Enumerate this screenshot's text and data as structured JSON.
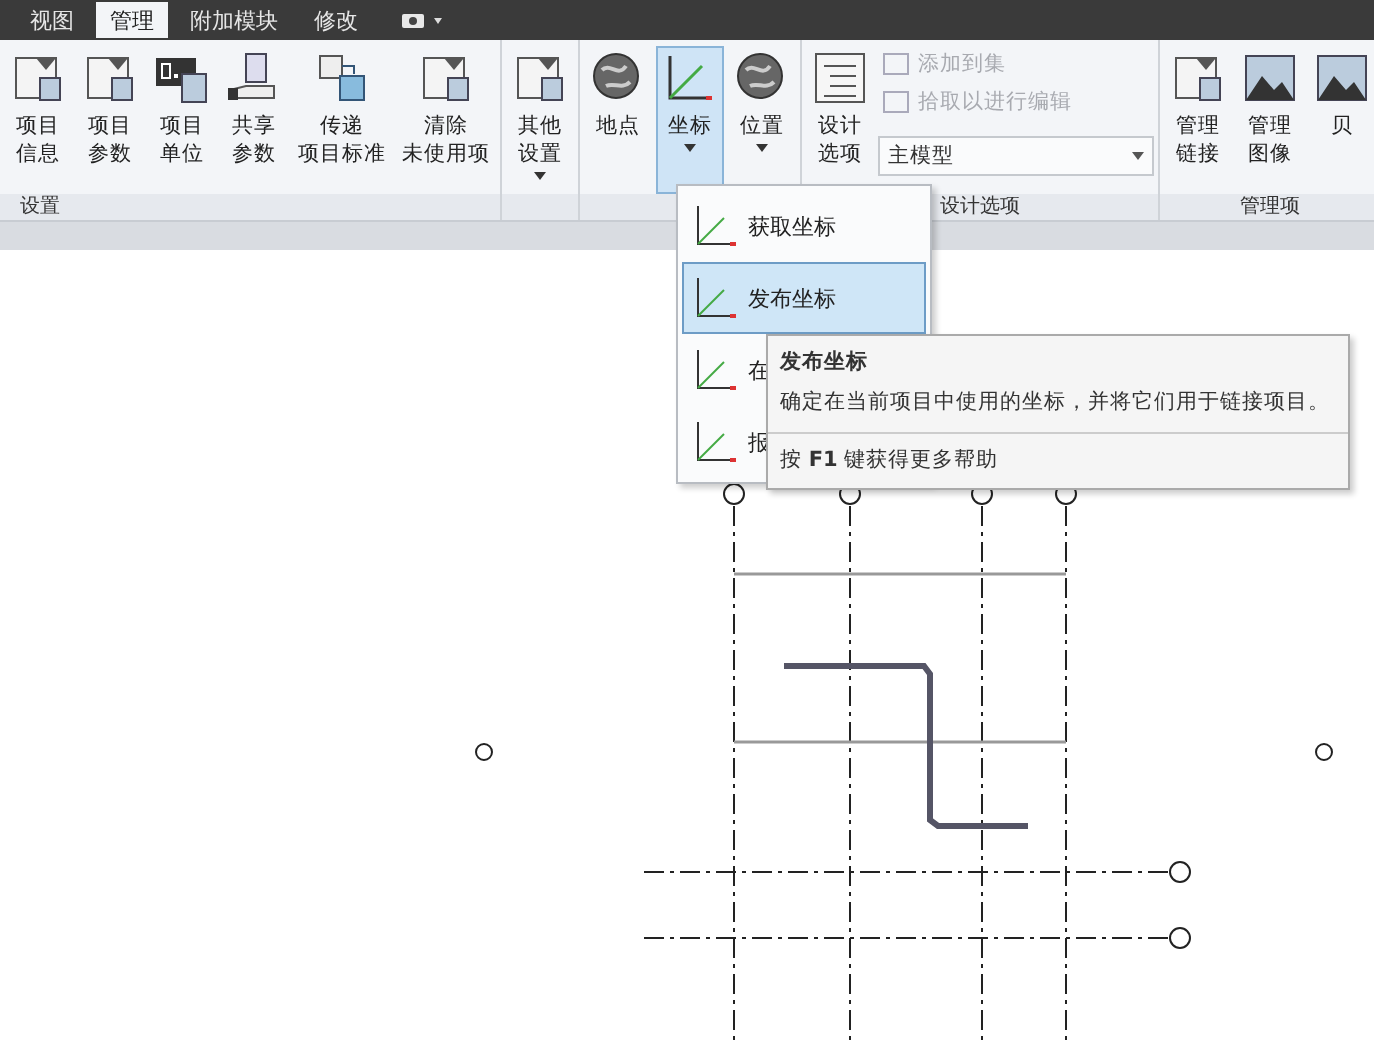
{
  "tabs": [
    {
      "label": "视图",
      "selected": false
    },
    {
      "label": "管理",
      "selected": true
    },
    {
      "label": "附加模块",
      "selected": false
    },
    {
      "label": "修改",
      "selected": false
    }
  ],
  "ribbon": {
    "groups": [
      {
        "label": "设置",
        "buttons": [
          {
            "lines": [
              "项目",
              "信息"
            ],
            "dropdown": false,
            "pressed": false
          },
          {
            "lines": [
              "项目",
              "参数"
            ],
            "dropdown": false,
            "pressed": false
          },
          {
            "lines": [
              "项目",
              "单位"
            ],
            "dropdown": false,
            "pressed": false
          },
          {
            "lines": [
              "共享",
              "参数"
            ],
            "dropdown": false,
            "pressed": false
          },
          {
            "lines": [
              "传递",
              "项目标准"
            ],
            "dropdown": false,
            "pressed": false
          },
          {
            "lines": [
              "清除",
              "未使用项"
            ],
            "dropdown": false,
            "pressed": false
          }
        ]
      },
      {
        "buttons": [
          {
            "lines": [
              "其他",
              "设置"
            ],
            "dropdown": true,
            "pressed": false
          }
        ]
      },
      {
        "buttons": [
          {
            "lines": [
              "地点"
            ],
            "dropdown": false,
            "pressed": false
          },
          {
            "lines": [
              "坐标"
            ],
            "dropdown": true,
            "pressed": true
          },
          {
            "lines": [
              "位置"
            ],
            "dropdown": true,
            "pressed": false
          }
        ]
      },
      {
        "label": "设计选项",
        "buttons": [
          {
            "lines": [
              "设计",
              "选项"
            ],
            "dropdown": false,
            "pressed": false
          }
        ],
        "small_buttons": [
          {
            "label": "添加到集",
            "disabled": true
          },
          {
            "label": "拾取以进行编辑",
            "disabled": true
          }
        ],
        "select": {
          "value": "主模型"
        }
      },
      {
        "label": "管理项",
        "buttons": [
          {
            "lines": [
              "管理",
              "链接"
            ],
            "dropdown": false,
            "pressed": false
          },
          {
            "lines": [
              "管理",
              "图像"
            ],
            "dropdown": false,
            "pressed": false
          },
          {
            "lines": [
              "贝"
            ],
            "dropdown": false,
            "pressed": false
          }
        ]
      }
    ]
  },
  "menu": {
    "items": [
      {
        "label": "获取坐标",
        "selected": false
      },
      {
        "label": "发布坐标",
        "selected": true
      },
      {
        "label": "在",
        "selected": false
      },
      {
        "label": "报",
        "selected": false
      }
    ]
  },
  "tooltip": {
    "title": "发布坐标",
    "text": "确定在当前项目中使用的坐标，并将它们用于链接项目。",
    "help": "按 **F1** 键获得更多帮助"
  }
}
